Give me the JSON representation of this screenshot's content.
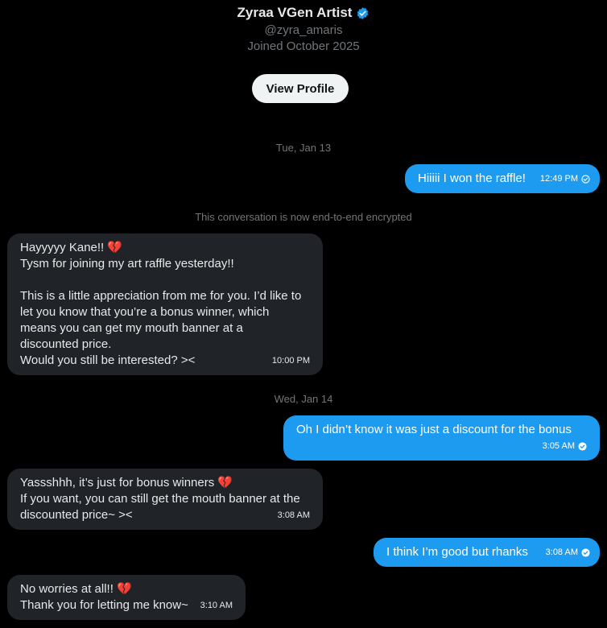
{
  "profile": {
    "name": "Zyraa VGen Artist",
    "handle": "@zyra_amaris",
    "joined": "Joined October 2025",
    "view_profile": "View Profile",
    "verified_color": "#1d9bf0"
  },
  "conversation": {
    "day1": "Tue, Jan 13",
    "day2": "Wed, Jan 14",
    "encrypted_notice": "This conversation is now end-to-end encrypted",
    "messages": [
      {
        "dir": "out",
        "text": "Hiiiii I won the raffle!",
        "time": "12:49 PM",
        "status": "sent"
      },
      {
        "dir": "in",
        "text": "Hayyyyy Kane!! 💔\nTysm for joining my art raffle yesterday!!\n\nThis is a little appreciation from me for you. I’d like to\nlet you know that you’re a bonus winner, which\nmeans you can get my mouth banner at a\ndiscounted price.\nWould you still be interested? ><",
        "time": "10:00 PM"
      },
      {
        "dir": "out",
        "text": "Oh I didn’t know it was just a discount for the bonus",
        "time": "3:05 AM",
        "status": "read"
      },
      {
        "dir": "in",
        "text": "Yassshhh, it’s just for bonus winners 💔\nIf you want, you can still get the mouth banner at the\ndiscounted price~ ><",
        "time": "3:08 AM"
      },
      {
        "dir": "out",
        "text": "I think I’m good but rhanks",
        "time": "3:08 AM",
        "status": "read"
      },
      {
        "dir": "in",
        "text": "No worries at all!! 💔\nThank you for letting me know~",
        "time": "3:10 AM"
      }
    ]
  },
  "colors": {
    "background": "#000000",
    "outgoing_bubble": "#1d9bf0",
    "incoming_bubble": "#202327",
    "muted_text": "#71767b"
  }
}
